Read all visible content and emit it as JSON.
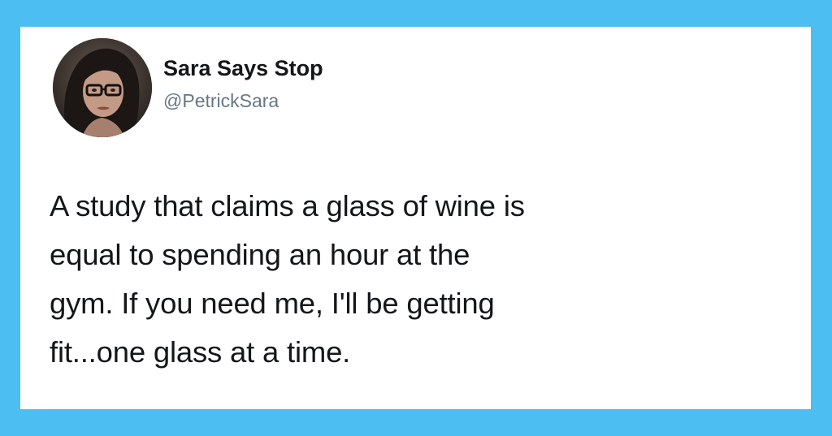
{
  "author": {
    "display_name": "Sara Says Stop",
    "handle": "@PetrickSara",
    "avatar_icon": "profile-photo"
  },
  "tweet": {
    "lines": [
      "A study that claims a glass of wine is",
      "equal to spending an hour at the",
      "gym. If you need me, I'll be getting",
      "fit...one glass at a time."
    ]
  },
  "colors": {
    "background": "#4dbef2",
    "card": "#ffffff",
    "text": "#14171a",
    "handle": "#657786"
  }
}
